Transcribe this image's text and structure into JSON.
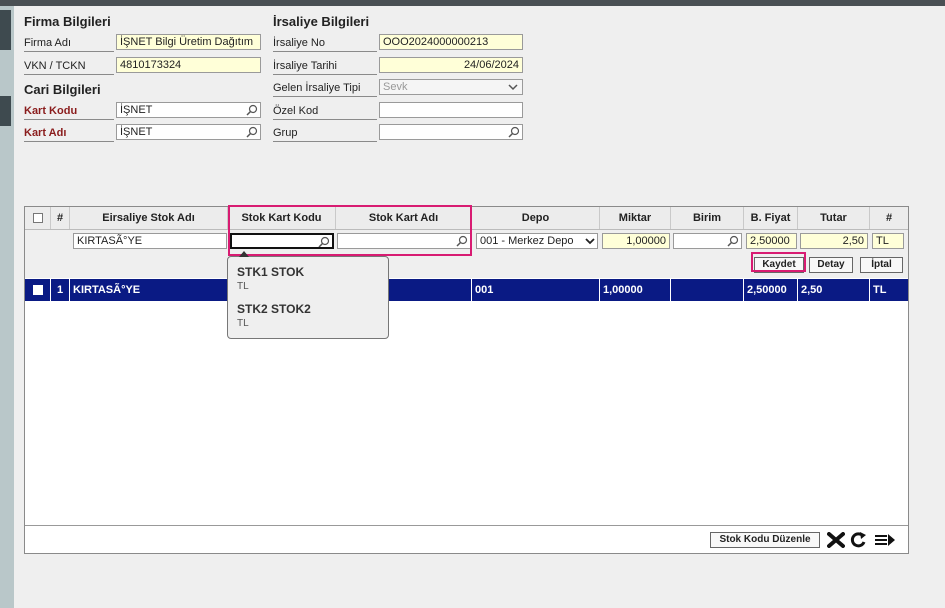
{
  "firma": {
    "title": "Firma Bilgileri",
    "firma_adi_label": "Firma Adı",
    "firma_adi_value": "İŞNET Bilgi Üretim Dağıtım",
    "vkn_label": "VKN / TCKN",
    "vkn_value": "4810173324"
  },
  "cari": {
    "title": "Cari Bilgileri",
    "kart_kodu_label": "Kart Kodu",
    "kart_kodu_value": "İŞNET",
    "kart_adi_label": "Kart Adı",
    "kart_adi_value": "İŞNET"
  },
  "irsaliye": {
    "title": "İrsaliye Bilgileri",
    "no_label": "İrsaliye No",
    "no_value": "OOO2024000000213",
    "tarih_label": "İrsaliye Tarihi",
    "tarih_value": "24/06/2024",
    "tip_label": "Gelen İrsaliye Tipi",
    "tip_value": "Sevk",
    "ozel_kod_label": "Özel Kod",
    "ozel_kod_value": "",
    "grup_label": "Grup",
    "grup_value": ""
  },
  "grid": {
    "headers": [
      "#",
      "Eirsaliye Stok Adı",
      "Stok Kart Kodu",
      "Stok Kart Adı",
      "Depo",
      "Miktar",
      "Birim",
      "B. Fiyat",
      "Tutar",
      "#"
    ],
    "edit": {
      "stok_adi": "KIRTASÃ°YE",
      "stok_kart_kodu": "",
      "stok_kart_adi": "",
      "depo": "001 - Merkez Depo",
      "miktar": "1,00000",
      "birim": "",
      "fiyat": "2,50000",
      "tutar": "2,50",
      "para": "TL"
    },
    "buttons": {
      "kaydet": "Kaydet",
      "detay": "Detay",
      "iptal": "İptal"
    },
    "rows": [
      {
        "no": "1",
        "stok_adi": "KIRTASÃ°YE",
        "depo": "001",
        "miktar": "1,00000",
        "fiyat": "2,50000",
        "tutar": "2,50",
        "para": "TL"
      }
    ],
    "stok_kodu_duzenle": "Stok Kodu Düzenle"
  },
  "dropdown": {
    "items": [
      {
        "code": "STK1 STOK",
        "unit": "TL"
      },
      {
        "code": "STK2 STOK2",
        "unit": "TL"
      }
    ]
  },
  "colors": {
    "highlight": "#d81b72",
    "selected_row": "#0a1a84",
    "label_red": "#8a1c1c",
    "input_yellow": "#ffffd8"
  },
  "icons": [
    "search-icon",
    "chevron-down-icon",
    "close-icon",
    "refresh-icon",
    "export-icon"
  ]
}
